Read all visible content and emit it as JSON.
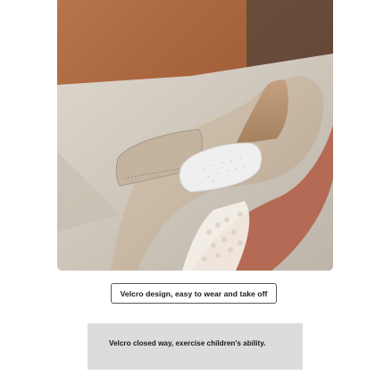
{
  "photo": {
    "subject": "beige suede child shoe with velcro strap and lace trim",
    "colors": {
      "wall_wood": "#a8643c",
      "floor": "#cfc8bd",
      "suede": "#c9b9a5",
      "velcro_hook": "#efefef",
      "sole": "#b56a55",
      "lace": "#f4f0e8"
    }
  },
  "caption": {
    "text": "Velcro design, easy to wear and take off"
  },
  "note": {
    "text": "Velcro closed way, exercise children's ability."
  }
}
